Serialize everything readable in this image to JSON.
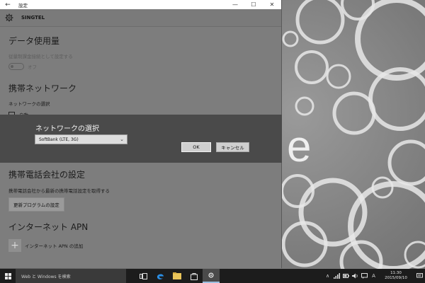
{
  "window": {
    "back_label": "←",
    "title": "設定",
    "minimize": "—",
    "maximize": "☐",
    "close": "✕",
    "header_network": "SINGTEL"
  },
  "data_usage": {
    "title": "データ使用量",
    "setting_text": "従量制課金接続として設定する",
    "toggle_state": "オフ"
  },
  "mobile_network": {
    "title": "携帯ネットワーク",
    "select_label": "ネットワークの選択",
    "auto_label": "自動"
  },
  "dialog": {
    "title": "ネットワークの選択",
    "selected_option": "SoftBank (LTE, 3G)",
    "ok_label": "OK",
    "cancel_label": "キャンセル"
  },
  "carrier": {
    "title": "携帯電話会社の設定",
    "description": "携帯電話会社から最新の携帯電話設定を取得する",
    "update_button": "更新プログラムの設定"
  },
  "apn": {
    "title": "インターネット APN",
    "add_label": "インターネット APN の追加"
  },
  "taskbar": {
    "search_placeholder": "Web と Windows を検索",
    "clock_time": "11:30",
    "clock_date": "2015/09/10",
    "ime_label": "A",
    "chevron": "∧"
  },
  "desktop": {
    "watermark_letter": "e"
  }
}
